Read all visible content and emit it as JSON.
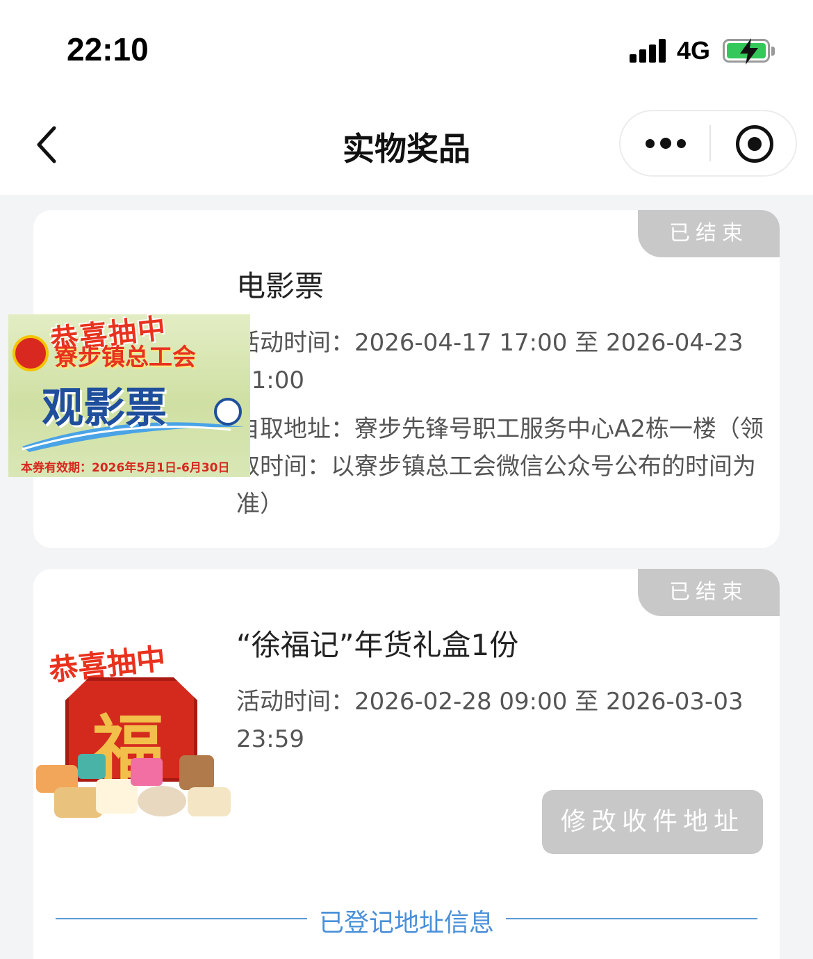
{
  "status_bar": {
    "time": "22:10",
    "network": "4G",
    "battery_color": "#34c759"
  },
  "nav": {
    "title": "实物奖品",
    "back_icon": "chevron-left-icon",
    "more_icon": "more-dots-icon",
    "close_icon": "target-circle-icon"
  },
  "prizes": [
    {
      "title": "电影票",
      "status": "已结束",
      "activity_time": "活动时间：2026-04-17 17:00 至 2026-04-23 01:00",
      "pickup_address": "自取地址：寮步先锋号职工服务中心A2栋一楼（领取时间：以寮步镇总工会微信公众号公布的时间为准）",
      "image": {
        "headline": "恭喜抽中",
        "union_name": "寮步镇总工会",
        "ticket_name": "观影票",
        "validity": "本券有效期：2026年5月1日-6月30日"
      }
    },
    {
      "title": "“徐福记”年货礼盒1份",
      "status": "已结束",
      "activity_time": "活动时间：2026-02-28 09:00 至 2026-03-03 23:59",
      "action_label": "修改收件地址",
      "image": {
        "headline": "恭喜抽中",
        "box_char": "福"
      }
    }
  ],
  "section": {
    "registered_address_label": "已登记地址信息"
  }
}
